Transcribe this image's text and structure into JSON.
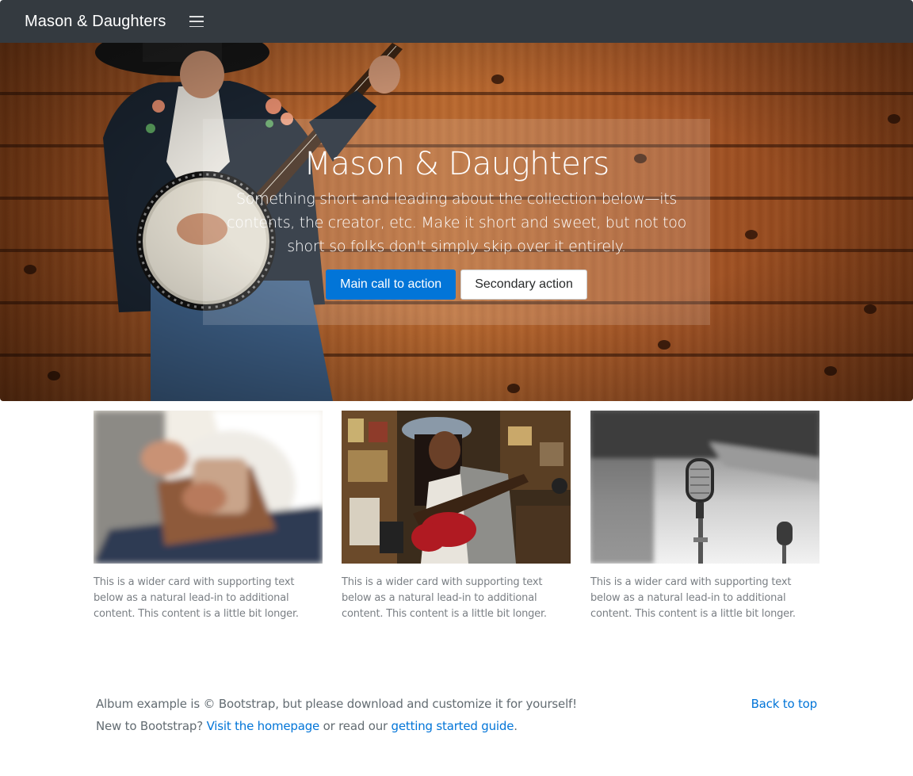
{
  "navbar": {
    "brand": "Mason & Daughters",
    "menu_icon": "hamburger-icon"
  },
  "hero": {
    "title": "Mason & Daughters",
    "lead": "Something short and leading about the collection below—its contents, the creator, etc. Make it short and sweet, but not too short so folks don't simply skip over it entirely.",
    "primary_button": "Main call to action",
    "secondary_button": "Secondary action",
    "image": "banjo-player-on-wood-wall"
  },
  "cards": [
    {
      "image": "guitar-player-blurred",
      "text": "This is a wider card with supporting text below as a natural lead-in to additional content. This content is a little bit longer."
    },
    {
      "image": "woman-with-red-guitar-in-record-store",
      "text": "This is a wider card with supporting text below as a natural lead-in to additional content. This content is a little bit longer."
    },
    {
      "image": "vintage-microphone-black-and-white",
      "text": "This is a wider card with supporting text below as a natural lead-in to additional content. This content is a little bit longer."
    }
  ],
  "footer": {
    "copyright": "Album example is © Bootstrap, but please download and customize it for yourself!",
    "new_prefix": "New to Bootstrap?",
    "homepage_link": "Visit the homepage",
    "middle_text": "or read our",
    "guide_link": "getting started guide",
    "end": ".",
    "back_to_top": "Back to top"
  },
  "colors": {
    "navbar": "#343a40",
    "primary": "#0275d8",
    "muted_text": "#7a7f84"
  }
}
